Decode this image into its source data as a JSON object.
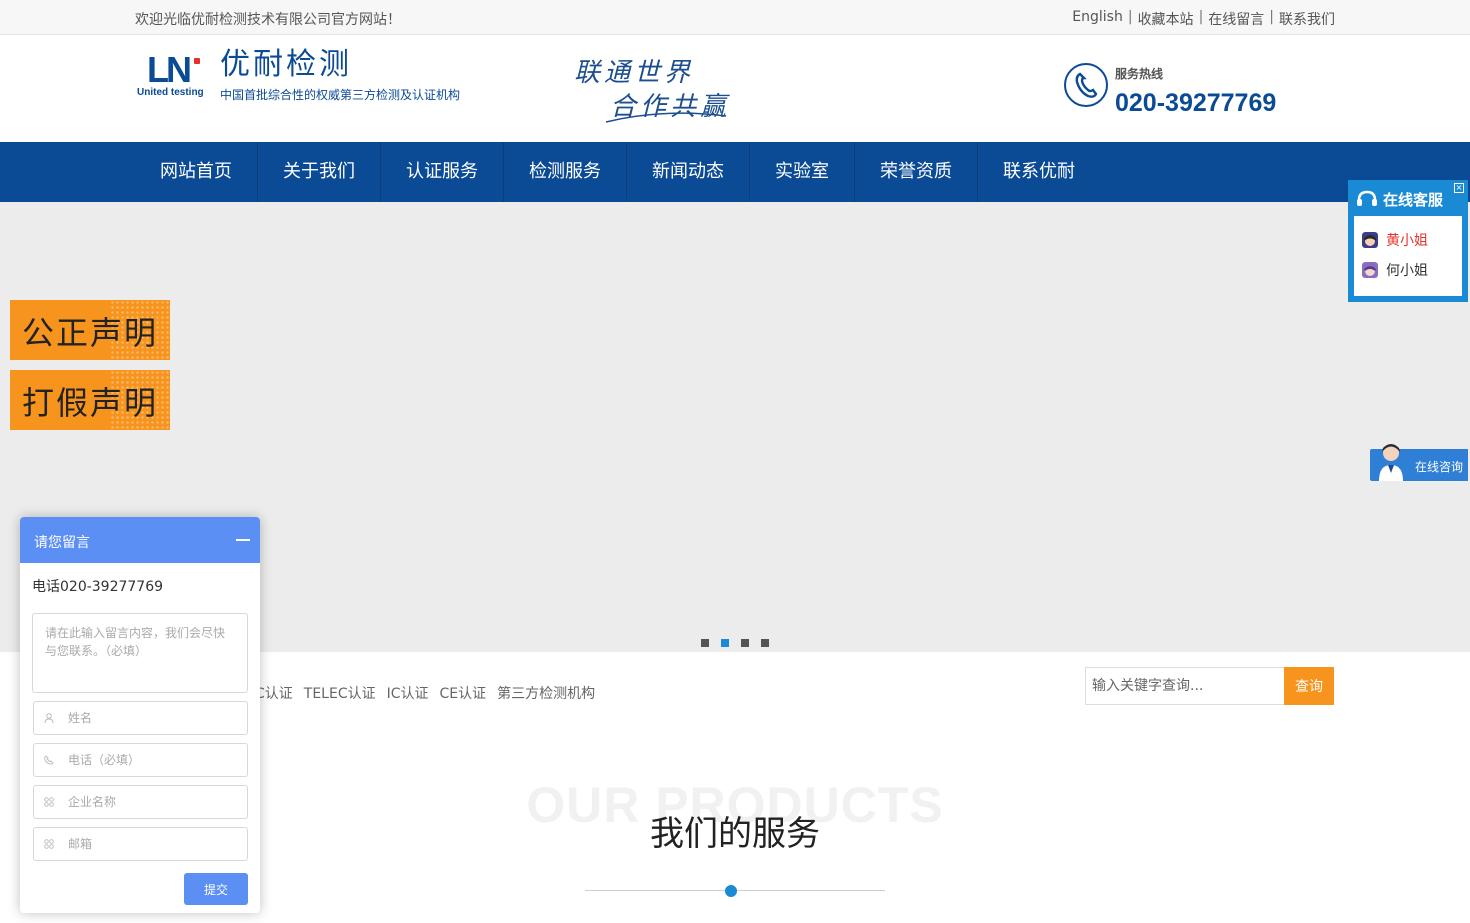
{
  "topbar": {
    "welcome": "欢迎光临优耐检测技术有限公司官方网站！",
    "links": [
      "English",
      "收藏本站",
      "在线留言",
      "联系我们"
    ],
    "separator": "|"
  },
  "header": {
    "logo_mark": "LN",
    "logo_sub": "United testing",
    "logo_cn": "优耐检测",
    "logo_tagline": "中国首批综合性的权威第三方检测及认证机构",
    "slogan_line1": "联通世界",
    "slogan_line2": "合作共赢",
    "hotline_label": "服务热线",
    "hotline_number": "020-39277769"
  },
  "nav": {
    "items": [
      "网站首页",
      "关于我们",
      "认证服务",
      "检测服务",
      "新闻动态",
      "实验室",
      "荣誉资质",
      "联系优耐"
    ]
  },
  "banner": {
    "dots_count": 4,
    "active_dot": 1
  },
  "notices": [
    "公正声明",
    "打假声明"
  ],
  "online_service": {
    "title": "在线客服",
    "close_glyph": "×",
    "agents": [
      {
        "name": "黄小姐",
        "color": "#e4322b"
      },
      {
        "name": "何小姐",
        "color": "#333333"
      }
    ],
    "consult_label": "在线咨询"
  },
  "hot_keywords": [
    "C认证",
    "TELEC认证",
    "IC认证",
    "CE认证",
    "第三方检测机构"
  ],
  "search": {
    "placeholder": "输入关键字查询...",
    "button": "查询"
  },
  "section": {
    "title_en": "OUR PRODUCTS",
    "title_cn": "我们的服务"
  },
  "message_box": {
    "title": "请您留言",
    "phone_line": "电话020-39277769",
    "content_placeholder": "请在此输入留言内容，我们会尽快与您联系。（必填）",
    "fields": [
      {
        "icon": "user-icon",
        "placeholder": "姓名"
      },
      {
        "icon": "phone-icon",
        "placeholder": "电话（必填）"
      },
      {
        "icon": "grid-icon",
        "placeholder": "企业名称"
      },
      {
        "icon": "grid-icon",
        "placeholder": "邮箱"
      }
    ],
    "submit": "提交"
  },
  "colors": {
    "brand_blue": "#0b4a94",
    "accent_blue": "#1a8ad4",
    "orange": "#f7941d",
    "message_blue": "#5b8ff4"
  }
}
